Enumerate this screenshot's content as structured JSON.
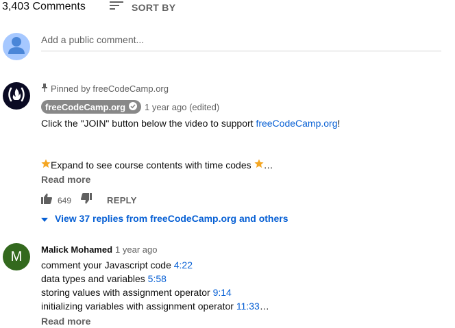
{
  "header": {
    "comment_count": "3,403 Comments",
    "sort_label": "SORT BY"
  },
  "composer": {
    "placeholder": "Add a public comment..."
  },
  "comments": [
    {
      "pinned_text": "Pinned by freeCodeCamp.org",
      "author": "freeCodeCamp.org",
      "time": "1 year ago (edited)",
      "line1_prefix": "Click the \"JOIN\" button below the video to support ",
      "line1_link": "freeCodeCamp.org",
      "line1_suffix": "!",
      "line2": "Expand to see course contents with time codes",
      "line2_ellipsis": "…",
      "read_more": "Read more",
      "likes": "649",
      "reply_label": "REPLY",
      "view_replies": "View 37 replies from freeCodeCamp.org and others"
    },
    {
      "avatar_letter": "M",
      "author": "Malick Mohamed",
      "time": "1 year ago",
      "lines": [
        {
          "text": "comment your Javascript code ",
          "ts": "4:22"
        },
        {
          "text": "data types and variables ",
          "ts": "5:58"
        },
        {
          "text": "storing values with assignment operator ",
          "ts": "9:14"
        },
        {
          "text": "initializing variables with assignment operator ",
          "ts": "11:33",
          "suffix": "…"
        }
      ],
      "read_more": "Read more"
    }
  ],
  "colors": {
    "link": "#065fd4",
    "secondary_text": "#606060",
    "fcc_avatar_bg": "#0a0a23",
    "m_avatar_bg": "#33691e",
    "author_chip_bg": "#888888",
    "star": "#f4a622"
  },
  "icons": [
    "sort-icon",
    "person-icon",
    "fcc-flame-icon",
    "pin-icon",
    "verified-check-icon",
    "star-icon",
    "thumb-up-icon",
    "thumb-down-icon",
    "caret-down-icon"
  ]
}
